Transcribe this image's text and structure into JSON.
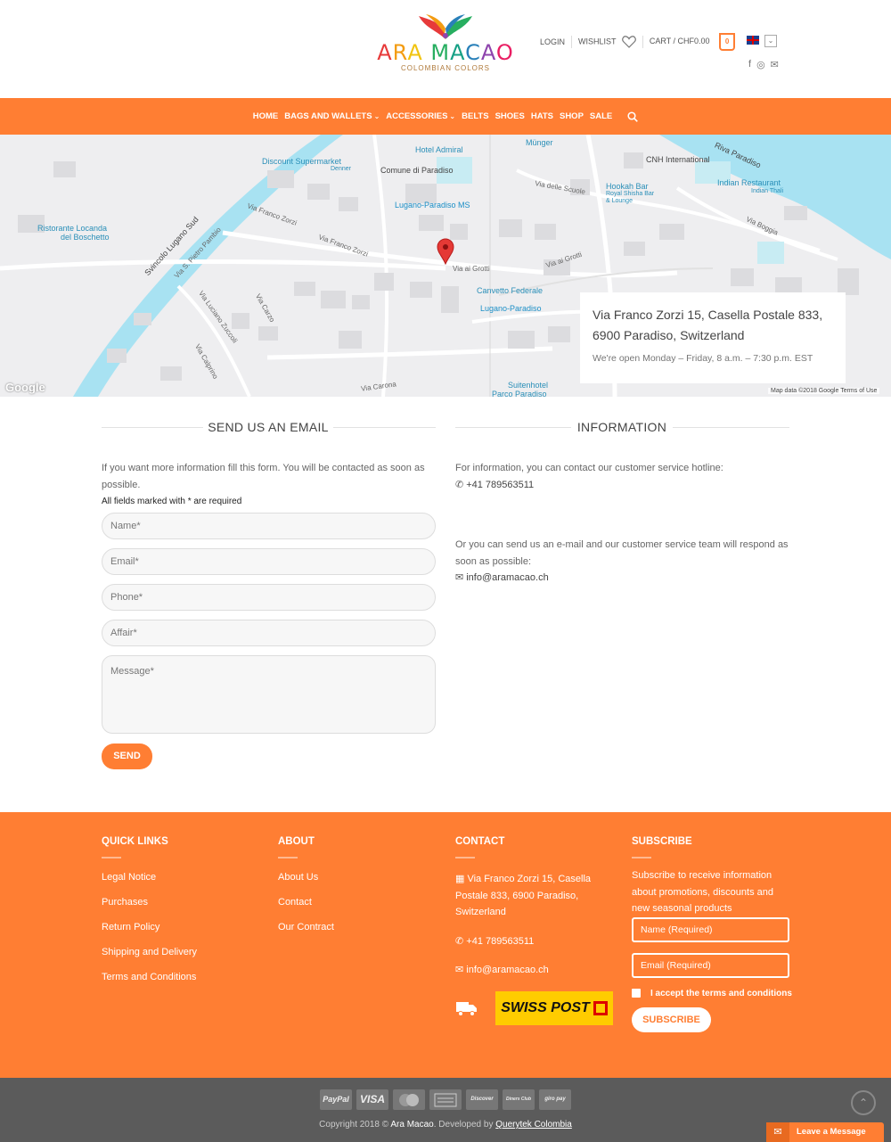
{
  "header": {
    "brand_letters": [
      "A",
      "R",
      "A",
      " ",
      "M",
      "A",
      "C",
      "A",
      "O"
    ],
    "brand": "ARA MACAO",
    "tagline": "COLOMBIAN COLORS",
    "login": "LOGIN",
    "wishlist": "WISHLIST",
    "cart": "CART / CHF0.00",
    "cart_count": "0",
    "lang_dropdown": "⌄",
    "social": [
      "f",
      "◎",
      "✉"
    ]
  },
  "nav": {
    "items": [
      "HOME",
      "BAGS AND WALLETS",
      "ACCESSORIES",
      "BELTS",
      "SHOES",
      "HATS",
      "SHOP",
      "SALE"
    ],
    "dropdown_chevron": "⌄"
  },
  "map": {
    "labels": {
      "hotel_admiral": "Hotel Admiral",
      "munger": "Münger",
      "cnh": "CNH International",
      "riva": "Riva Paradiso",
      "discount": "Discount Supermarket",
      "denner": "Denner",
      "comune": "Comune di Paradiso",
      "scuole": "Via delle Scuole",
      "hookah": "Hookah Bar",
      "hookah_sub": "Royal Shisha Bar & Lounge",
      "indian": "Indian Restaurant",
      "indian_sub": "Indian Thali",
      "lugano_ms": "Lugano-Paradiso MS",
      "ristorante": "Ristorante Locanda",
      "boschetto": "del Boschetto",
      "svincolo": "Svincolo Lugano Sud",
      "franco_zorzi": "Via Franco Zorzi",
      "via_ai_grotti": "Via ai Grotti",
      "canvetto": "Canvetto Federale",
      "lugano_paradiso": "Lugano-Paradiso",
      "via_boggia": "Via Boggia",
      "suitenhotel": "Suitenhotel",
      "parco": "Parco Paradiso",
      "via_carona": "Via Carona",
      "via_carzo": "Via Carzo",
      "via_zuccoli": "Via Luciano Zuccoli",
      "via_calprino": "Via Calprino",
      "pietro": "Via S. Pietro Pambio"
    },
    "google": "Google",
    "map_data": "Map data ©2018 Google   Terms of Use",
    "address": "Via Franco Zorzi 15, Casella Postale 833, 6900 Paradiso, Switzerland",
    "hours": "We're open Monday – Friday, 8 a.m. – 7:30 p.m. EST"
  },
  "form": {
    "title": "SEND US AN EMAIL",
    "intro": "If you want more information fill this form. You will be contacted as soon as possible.",
    "required_note": "All fields marked with * are required",
    "name_placeholder": "Name*",
    "email_placeholder": "Email*",
    "phone_placeholder": "Phone*",
    "affair_placeholder": "Affair*",
    "message_placeholder": "Message*",
    "send": "SEND"
  },
  "info": {
    "title": "INFORMATION",
    "hotline_text": "For information, you can contact our customer service hotline:",
    "phone": "+41 789563511",
    "email_text": "Or you can send us an e-mail and our customer service team will respond as soon as possible:",
    "email": "info@aramacao.ch"
  },
  "footer": {
    "quick_links": {
      "title": "QUICK LINKS",
      "items": [
        "Legal Notice",
        "Purchases",
        "Return Policy",
        "Shipping and Delivery",
        "Terms and Conditions"
      ]
    },
    "about": {
      "title": "ABOUT",
      "items": [
        "About Us",
        "Contact",
        "Our Contract"
      ]
    },
    "contact": {
      "title": "CONTACT",
      "address": "Via Franco Zorzi 15, Casella Postale 833, 6900 Paradiso, Switzerland",
      "phone": "+41 789563511",
      "email": "info@aramacao.ch",
      "swiss_post": "SWISS POST"
    },
    "subscribe": {
      "title": "SUBSCRIBE",
      "text": "Subscribe to receive information about promotions, discounts and new seasonal products",
      "name_placeholder": "Name (Required)",
      "email_placeholder": "Email (Required)",
      "terms": "I accept the terms and conditions",
      "button": "SUBSCRIBE"
    }
  },
  "bottom": {
    "payments": [
      "PayPal",
      "VISA",
      "MasterCard",
      "Bank",
      "Discover",
      "Diners Club",
      "giro pay"
    ],
    "copyright_prefix": "Copyright 2018 © ",
    "brand": "Ara Macao",
    "developed": ". Developed by ",
    "developer": "Querytek Colombia",
    "to_top": "⌃",
    "leave_message": "Leave a Message"
  },
  "colors": {
    "accent": "#ff7e33",
    "bottom_bar": "#5b5b5b",
    "water": "#a8e2f2"
  }
}
